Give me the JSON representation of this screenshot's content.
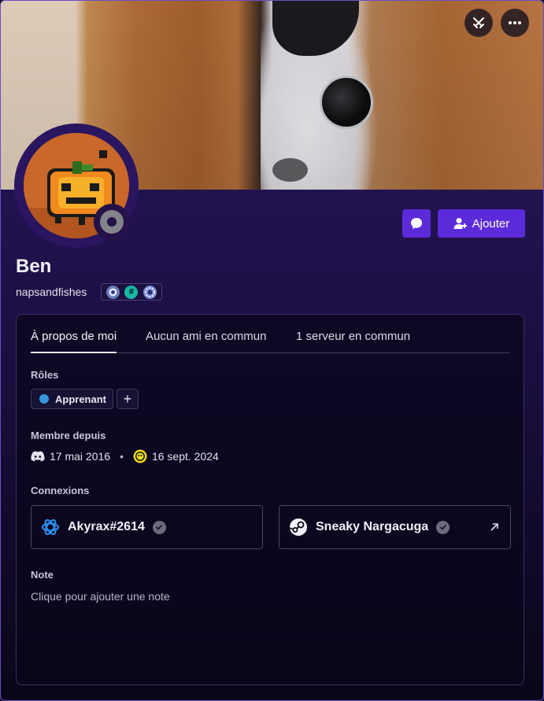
{
  "profile": {
    "display_name": "Ben",
    "username": "napsandfishes",
    "status": "offline"
  },
  "header": {
    "game_button_icon": "swords-icon",
    "more_button_icon": "more-icon"
  },
  "actions": {
    "message_icon": "chat-bubble-icon",
    "add_label": "Ajouter"
  },
  "tabs": [
    {
      "label": "À propos de moi",
      "active": true
    },
    {
      "label": "Aucun ami en commun",
      "active": false
    },
    {
      "label": "1 serveur en commun",
      "active": false
    }
  ],
  "roles": {
    "title": "Rôles",
    "items": [
      {
        "label": "Apprenant",
        "color": "#3497da"
      }
    ],
    "add_symbol": "+"
  },
  "member_since": {
    "title": "Membre depuis",
    "discord_date": "17 mai 2016",
    "separator": "•",
    "server_date": "16 sept. 2024"
  },
  "connections": {
    "title": "Connexions",
    "items": [
      {
        "platform": "battle-net",
        "name": "Akyrax#2614",
        "verified": true
      },
      {
        "platform": "steam",
        "name": "Sneaky Nargacuga",
        "verified": true,
        "external": true
      }
    ]
  },
  "note": {
    "title": "Note",
    "placeholder": "Clique pour ajouter une note"
  },
  "colors": {
    "accent": "#5c2bd9",
    "border": "#6a4fc9"
  }
}
